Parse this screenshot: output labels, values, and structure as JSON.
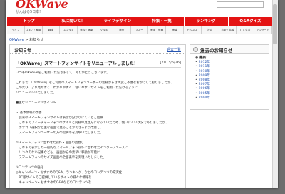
{
  "header": {
    "logo": "OKWave",
    "tagline": "がんばる5日本!"
  },
  "nav": [
    "トップ",
    "私に聞いて！",
    "ライフデザイン",
    "特集・一覧",
    "ランキング",
    "Q&Aクイズ"
  ],
  "subnav": [
    "ライフ",
    "住まい・家電",
    "趣味",
    "エンタメ",
    "美容・健康",
    "グルメ",
    "旅行",
    "マネー",
    "教育・就職",
    "地域",
    "ビジネス",
    "社会",
    "恋愛・結婚",
    "ITと生活",
    "アンケート"
  ],
  "breadcrumb": {
    "home": "OKWave",
    "separator": " > ",
    "current": "お知らせ"
  },
  "main": {
    "section_title": "お知らせ",
    "section_link": "過去一覧",
    "article": {
      "title": "「OKWave」スマートフォンサイトをリニューアルしました！",
      "date": "[2013/6/26]"
    },
    "lines": [
      "いつもOKWaveをご利用いただきまして、ありがとうございます。",
      "",
      "これまで、「OKWave」をご利用のスマートフォンユーザーの皆様からは大変ご不便をおかけしておりましたが、",
      "このたび、より見やすく、わかりやすく、使いやすいサイトをご利用いただけるように",
      "リニューアルいたしました。",
      "",
      "■主なリニューアルポイント",
      "",
      "・ 基本情報の改善",
      "　従来のスマートフォンサイトは表示が分かりにくいとご指摘",
      "　これまでフィーチャーフォンのサイトと同様の見せ方になっていたため、使いにくい状況でありましたが、",
      "　カテゴリ選択など主な画面で見ることができるよう改善し、",
      "　スマートフォンユーザーの方の指摘等を反映いたしました。",
      "",
      "②スマートフォンに合わせた操作・画面の見直し",
      "　これまで表示した一般的なスマートフォン操作に合わせたインターフェースに",
      "　リンクのない記事なども、画面からの素早い移動が可能に",
      "　スマートフォンのサイズ画面の全面表示を実現いたしました。",
      "",
      "③コンテンツの強化",
      "◎キャンペーン・おすすめのQ&A、ランキング、などのコンテンツの充実化",
      "　PC版サイトでご提供しているサイトの様々な情報を",
      "　キャンペーン・おすすめのQ&Aなどのコンテンツを"
    ]
  },
  "side": {
    "title": "過去のお知らせ",
    "items": [
      "最新",
      "2012年",
      "2011年",
      "2010年",
      "2009年",
      "2008年",
      "2007年",
      "2006年",
      "2005年",
      "2004年"
    ]
  }
}
